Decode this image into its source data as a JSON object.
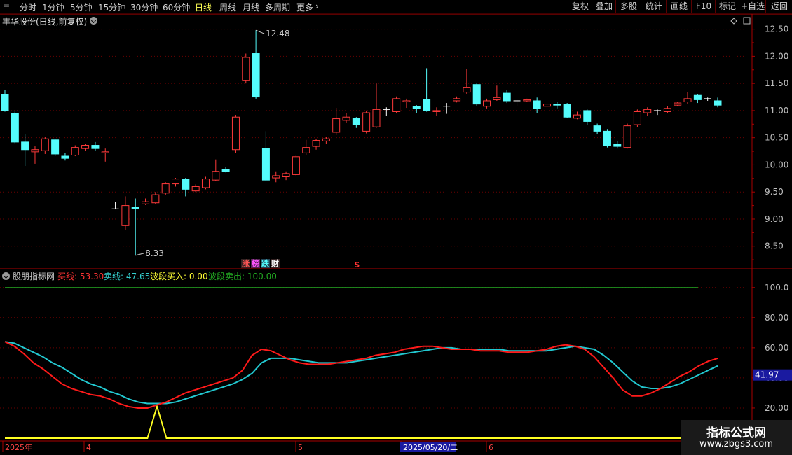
{
  "toolbar": {
    "periods": [
      {
        "label": "分时",
        "active": false
      },
      {
        "label": "1分钟",
        "active": false
      },
      {
        "label": "5分钟",
        "active": false
      },
      {
        "label": "15分钟",
        "active": false
      },
      {
        "label": "30分钟",
        "active": false
      },
      {
        "label": "60分钟",
        "active": false
      },
      {
        "label": "日线",
        "active": true
      },
      {
        "label": "周线",
        "active": false
      },
      {
        "label": "月线",
        "active": false
      },
      {
        "label": "多周期",
        "active": false
      },
      {
        "label": "更多",
        "active": false
      }
    ],
    "right_buttons": [
      "复权",
      "叠加",
      "多股",
      "统计",
      "画线",
      "F10",
      "标记",
      "+自选",
      "返回"
    ]
  },
  "main_chart": {
    "title": "丰华股份(日线,前复权)",
    "high_label": "12.48",
    "low_label": "8.33",
    "tags": [
      {
        "text": "涨",
        "color": "#ff5555"
      },
      {
        "text": "榜",
        "color": "#ff55ff"
      },
      {
        "text": "跌",
        "color": "#55ffff"
      },
      {
        "text": "财",
        "color": "#ffffff"
      }
    ],
    "signal_mark": "S",
    "y_ticks": [
      "12.50",
      "12.00",
      "11.50",
      "11.00",
      "10.50",
      "10.00",
      "9.50",
      "9.00",
      "8.50"
    ]
  },
  "sub_chart": {
    "name": "股朋指标网",
    "legend": [
      {
        "label": "买线:",
        "value": "53.30",
        "color": "#ff3333"
      },
      {
        "label": "卖线:",
        "value": "47.65",
        "color": "#33cccc"
      },
      {
        "label": "波段买入:",
        "value": "0.00",
        "color": "#ffff33"
      },
      {
        "label": "波段卖出:",
        "value": "100.00",
        "color": "#22aa22"
      }
    ],
    "y_ticks": [
      "100.0",
      "80.00",
      "60.00",
      "40.00",
      "20.00"
    ],
    "current_value": "41.97"
  },
  "x_axis": {
    "labels": [
      "2025年",
      "4",
      "5",
      "2025/05/20/二",
      "6"
    ]
  },
  "watermark": {
    "line1": "指标公式网",
    "line2": "www.zbgs3.com"
  },
  "colors": {
    "up": "#ff3a3a",
    "down": "#54fcfc",
    "buy_line": "#ff1a1a",
    "sell_line": "#22c8d0",
    "band_buy": "#ffff22",
    "band_sell": "#22aa22"
  },
  "chart_data": [
    {
      "type": "candlestick",
      "y_range": [
        8.2,
        12.65
      ],
      "high": 12.48,
      "low": 8.33,
      "candles": [
        [
          11.3,
          11.0,
          11.38,
          10.98
        ],
        [
          10.95,
          10.42,
          10.98,
          10.4
        ],
        [
          10.42,
          10.28,
          10.57,
          9.98
        ],
        [
          10.24,
          10.28,
          10.34,
          10.02
        ],
        [
          10.26,
          10.48,
          10.52,
          10.2
        ],
        [
          10.46,
          10.2,
          10.48,
          10.16
        ],
        [
          10.16,
          10.12,
          10.22,
          10.08
        ],
        [
          10.18,
          10.32,
          10.36,
          10.16
        ],
        [
          10.3,
          10.36,
          10.38,
          10.26
        ],
        [
          10.36,
          10.3,
          10.42,
          10.26
        ],
        [
          10.22,
          10.24,
          10.3,
          10.06
        ],
        [
          9.18,
          9.19,
          9.32,
          9.18
        ],
        [
          8.88,
          9.25,
          9.42,
          8.8
        ],
        [
          9.22,
          9.2,
          9.38,
          8.33
        ],
        [
          9.28,
          9.32,
          9.38,
          9.26
        ],
        [
          9.3,
          9.45,
          9.5,
          9.28
        ],
        [
          9.48,
          9.65,
          9.68,
          9.44
        ],
        [
          9.65,
          9.74,
          9.76,
          9.6
        ],
        [
          9.73,
          9.55,
          9.76,
          9.42
        ],
        [
          9.52,
          9.6,
          9.64,
          9.5
        ],
        [
          9.58,
          9.74,
          9.78,
          9.55
        ],
        [
          9.72,
          9.88,
          10.1,
          9.7
        ],
        [
          9.92,
          9.88,
          9.96,
          9.86
        ],
        [
          10.28,
          10.88,
          10.92,
          10.22
        ],
        [
          11.55,
          11.98,
          12.05,
          11.5
        ],
        [
          12.05,
          11.25,
          12.48,
          11.22
        ],
        [
          10.3,
          9.72,
          10.62,
          9.7
        ],
        [
          9.76,
          9.8,
          9.88,
          9.68
        ],
        [
          9.78,
          9.84,
          9.88,
          9.72
        ],
        [
          9.82,
          10.15,
          10.18,
          9.8
        ],
        [
          10.22,
          10.32,
          10.46,
          10.18
        ],
        [
          10.34,
          10.45,
          10.48,
          10.28
        ],
        [
          10.44,
          10.48,
          10.52,
          10.38
        ],
        [
          10.6,
          10.85,
          11.05,
          10.55
        ],
        [
          10.82,
          10.88,
          10.95,
          10.78
        ],
        [
          10.86,
          10.74,
          10.88,
          10.68
        ],
        [
          10.62,
          10.96,
          11.0,
          10.58
        ],
        [
          10.7,
          11.02,
          11.5,
          10.68
        ],
        [
          11.02,
          11.02,
          11.06,
          10.9
        ],
        [
          10.98,
          11.22,
          11.26,
          10.96
        ],
        [
          11.16,
          11.18,
          11.22,
          11.05
        ],
        [
          11.08,
          11.04,
          11.1,
          10.96
        ],
        [
          11.2,
          11.0,
          11.78,
          10.98
        ],
        [
          10.98,
          11.0,
          11.06,
          10.9
        ],
        [
          11.08,
          11.08,
          11.14,
          10.94
        ],
        [
          11.18,
          11.22,
          11.26,
          11.15
        ],
        [
          11.34,
          11.42,
          11.76,
          11.3
        ],
        [
          11.48,
          11.12,
          11.5,
          11.08
        ],
        [
          11.08,
          11.18,
          11.22,
          11.04
        ],
        [
          11.2,
          11.24,
          11.46,
          11.18
        ],
        [
          11.32,
          11.18,
          11.38,
          11.14
        ],
        [
          11.18,
          11.18,
          11.2,
          11.08
        ],
        [
          11.18,
          11.2,
          11.22,
          11.16
        ],
        [
          11.18,
          11.04,
          11.24,
          10.95
        ],
        [
          11.08,
          11.12,
          11.16,
          11.04
        ],
        [
          11.12,
          11.1,
          11.16,
          11.04
        ],
        [
          11.12,
          10.88,
          11.14,
          10.86
        ],
        [
          10.86,
          10.92,
          10.98,
          10.84
        ],
        [
          11.0,
          10.8,
          11.02,
          10.74
        ],
        [
          10.72,
          10.62,
          10.76,
          10.56
        ],
        [
          10.62,
          10.36,
          10.66,
          10.32
        ],
        [
          10.38,
          10.34,
          10.44,
          10.3
        ],
        [
          10.32,
          10.72,
          10.76,
          10.3
        ],
        [
          10.74,
          10.98,
          11.02,
          10.7
        ],
        [
          10.96,
          11.02,
          11.06,
          10.9
        ],
        [
          11.0,
          11.0,
          11.02,
          10.92
        ],
        [
          10.98,
          11.04,
          11.08,
          10.96
        ],
        [
          11.1,
          11.14,
          11.16,
          11.08
        ],
        [
          11.16,
          11.22,
          11.34,
          11.12
        ],
        [
          11.28,
          11.2,
          11.3,
          11.14
        ],
        [
          11.22,
          11.22,
          11.24,
          11.18
        ],
        [
          11.18,
          11.1,
          11.24,
          11.06
        ]
      ]
    },
    {
      "type": "line",
      "y_range": [
        0,
        105
      ],
      "series": [
        {
          "name": "买线",
          "values": [
            64,
            61,
            56,
            50,
            46,
            41,
            36,
            33,
            31,
            29,
            28,
            26,
            23,
            21,
            20,
            20,
            22,
            24,
            27,
            30,
            32,
            34,
            36,
            38,
            40,
            45,
            55,
            59,
            58,
            55,
            52,
            50,
            49,
            49,
            49,
            50,
            51,
            52,
            53,
            55,
            56,
            57,
            59,
            60,
            61,
            61,
            60,
            59,
            59,
            59,
            58,
            58,
            58,
            57,
            57,
            57,
            58,
            59,
            61,
            62,
            61,
            59,
            54,
            47,
            40,
            32,
            28,
            28,
            30,
            33,
            37,
            41,
            44,
            48,
            51,
            53
          ]
        },
        {
          "name": "卖线",
          "values": [
            64,
            63,
            60,
            57,
            54,
            50,
            47,
            43,
            39,
            36,
            34,
            31,
            29,
            26,
            24,
            23,
            23,
            23,
            24,
            26,
            28,
            30,
            32,
            34,
            36,
            39,
            43,
            50,
            53,
            53,
            53,
            52,
            51,
            50,
            50,
            50,
            50,
            51,
            52,
            53,
            54,
            55,
            56,
            57,
            58,
            59,
            60,
            60,
            59,
            59,
            59,
            59,
            59,
            58,
            58,
            58,
            58,
            58,
            59,
            60,
            61,
            60,
            59,
            55,
            50,
            44,
            38,
            34,
            33,
            33,
            34,
            36,
            39,
            42,
            45,
            48
          ]
        },
        {
          "name": "波段买入",
          "values": [
            0,
            0,
            0,
            0,
            0,
            0,
            0,
            0,
            0,
            0,
            0,
            0,
            0,
            0,
            0,
            0,
            21,
            0,
            0,
            0,
            0,
            0,
            0,
            0,
            0,
            0,
            0,
            0,
            0,
            0,
            0,
            0,
            0,
            0,
            0,
            0,
            0,
            0,
            0,
            0,
            0,
            0,
            0,
            0,
            0,
            0,
            0,
            0,
            0,
            0,
            0,
            0,
            0,
            0,
            0,
            0,
            0,
            0,
            0,
            0,
            0,
            0,
            0,
            0,
            0,
            0,
            0,
            0,
            0,
            0,
            0,
            0,
            0,
            0,
            0,
            0
          ]
        },
        {
          "name": "波段卖出",
          "values": [
            100,
            100
          ]
        }
      ]
    }
  ]
}
